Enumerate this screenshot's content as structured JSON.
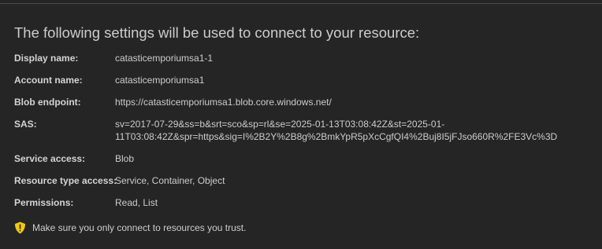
{
  "heading": "The following settings will be used to connect to your resource:",
  "fields": {
    "display_name": {
      "label": "Display name:",
      "value": "catasticemporiumsa1-1"
    },
    "account_name": {
      "label": "Account name:",
      "value": "catasticemporiumsa1"
    },
    "blob_endpoint": {
      "label": "Blob endpoint:",
      "value": "https://catasticemporiumsa1.blob.core.windows.net/"
    },
    "sas": {
      "label": "SAS:",
      "value_line1": "sv=2017-07-29&ss=b&srt=sco&sp=rl&se=2025-01-13T03:08:42Z&st=2025-01-",
      "value_line2": "11T03:08:42Z&spr=https&sig=I%2B2Y%2B8g%2BmkYpR5pXcCgfQI4%2Buj8I5jFJso660R%2FE3Vc%3D"
    },
    "service_access": {
      "label": "Service access:",
      "value": "Blob"
    },
    "resource_type_access": {
      "label": "Resource type access:",
      "value": "Service, Container, Object"
    },
    "permissions": {
      "label": "Permissions:",
      "value": "Read, List"
    }
  },
  "warning": {
    "icon": "warning-shield-icon",
    "text": "Make sure you only connect to resources you trust."
  },
  "colors": {
    "background": "#252526",
    "text": "#cccccc",
    "warning_icon": "#f2c811"
  }
}
